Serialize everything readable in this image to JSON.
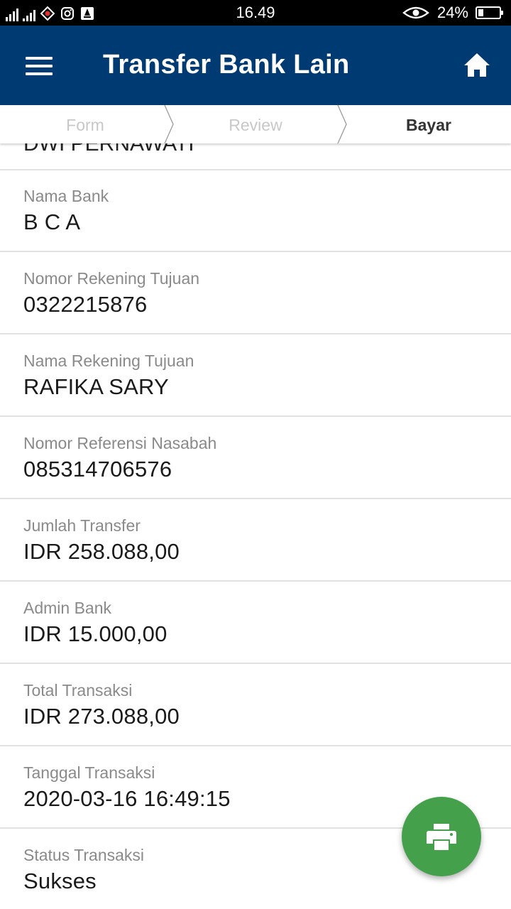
{
  "status_bar": {
    "time": "16.49",
    "battery_percent": "24%",
    "battery_level": 0.24,
    "icons": [
      "signal-icon",
      "signal-icon",
      "app-notification-icon",
      "instagram-icon",
      "app-notification-icon",
      "eye-icon",
      "battery-icon"
    ]
  },
  "header": {
    "title": "Transfer Bank Lain",
    "menu_icon": "hamburger-menu-icon",
    "home_icon": "home-icon",
    "background_color": "#003a73"
  },
  "stepper": {
    "steps": [
      {
        "label": "Form",
        "active": false
      },
      {
        "label": "Review",
        "active": false
      },
      {
        "label": "Bayar",
        "active": true
      }
    ]
  },
  "details": {
    "partial_value": "DWI PERNAWATI",
    "rows": [
      {
        "label": "Nama Bank",
        "value": "B C A"
      },
      {
        "label": "Nomor Rekening Tujuan",
        "value": "0322215876"
      },
      {
        "label": "Nama Rekening Tujuan",
        "value": "RAFIKA SARY"
      },
      {
        "label": "Nomor Referensi Nasabah",
        "value": "085314706576"
      },
      {
        "label": "Jumlah Transfer",
        "value": "IDR 258.088,00"
      },
      {
        "label": "Admin Bank",
        "value": "IDR 15.000,00"
      },
      {
        "label": "Total Transaksi",
        "value": "IDR 273.088,00"
      },
      {
        "label": "Tanggal Transaksi",
        "value": "2020-03-16 16:49:15"
      },
      {
        "label": "Status Transaksi",
        "value": "Sukses"
      }
    ]
  },
  "fab": {
    "icon": "printer-icon",
    "color": "#44a04a"
  }
}
